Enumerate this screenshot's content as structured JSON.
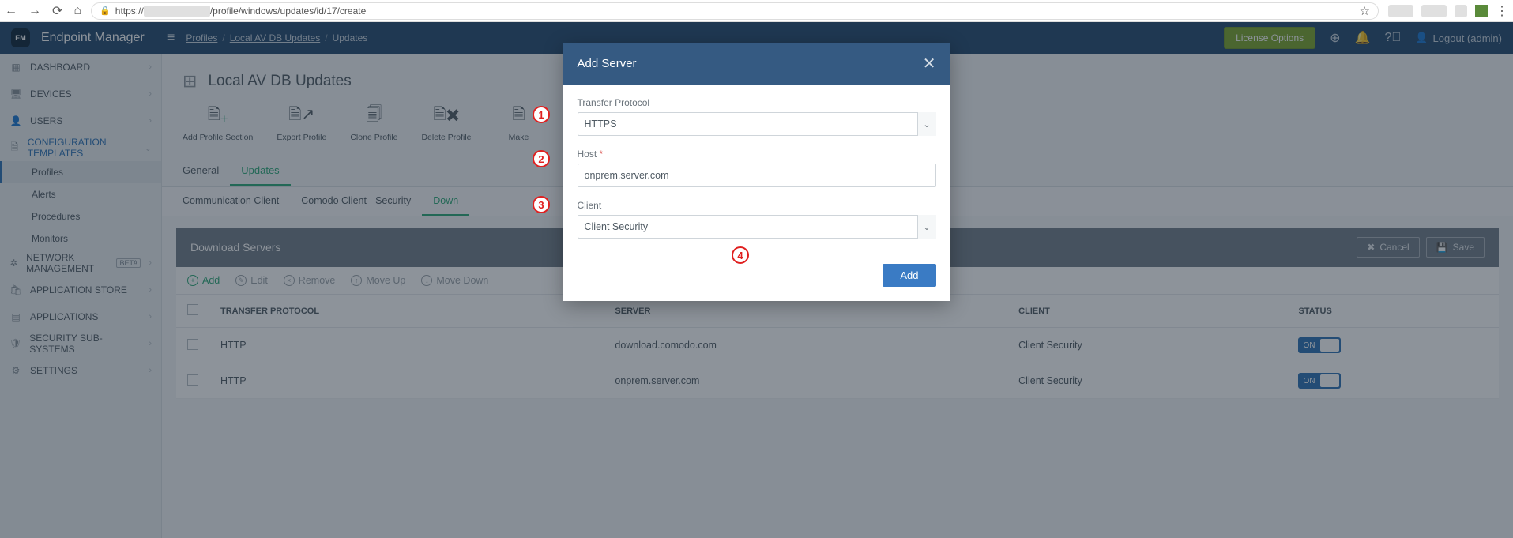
{
  "browser": {
    "url_prefix": "https://",
    "url_mid": "/profile/windows/updates/id/17/create"
  },
  "app": {
    "name": "Endpoint Manager",
    "breadcrumbs": {
      "a": "Profiles",
      "b": "Local AV DB Updates",
      "c": "Updates"
    },
    "license_btn": "License Options",
    "logout": "Logout (admin)"
  },
  "sidebar": {
    "dashboard": "DASHBOARD",
    "devices": "DEVICES",
    "users": "USERS",
    "cfg": "CONFIGURATION TEMPLATES",
    "profiles": "Profiles",
    "alerts": "Alerts",
    "procedures": "Procedures",
    "monitors": "Monitors",
    "network": "NETWORK MANAGEMENT",
    "beta": "BETA",
    "appstore": "APPLICATION STORE",
    "applications": "APPLICATIONS",
    "security": "SECURITY SUB-SYSTEMS",
    "settings": "SETTINGS"
  },
  "page": {
    "title": "Local AV DB Updates",
    "actions": {
      "add_section": "Add Profile Section",
      "export": "Export Profile",
      "clone": "Clone Profile",
      "delete": "Delete Profile",
      "make": "Make"
    },
    "tabs": {
      "general": "General",
      "updates": "Updates"
    },
    "subtabs": {
      "comm": "Communication Client",
      "ccs": "Comodo Client - Security",
      "down": "Down"
    }
  },
  "panel": {
    "title": "Download Servers",
    "cancel": "Cancel",
    "save": "Save",
    "toolbar": {
      "add": "Add",
      "edit": "Edit",
      "remove": "Remove",
      "moveup": "Move Up",
      "movedown": "Move Down"
    },
    "columns": {
      "proto": "TRANSFER PROTOCOL",
      "server": "SERVER",
      "client": "CLIENT",
      "status": "STATUS"
    },
    "rows": [
      {
        "proto": "HTTP",
        "server": "download.comodo.com",
        "client": "Client Security",
        "status": "ON"
      },
      {
        "proto": "HTTP",
        "server": "onprem.server.com",
        "client": "Client Security",
        "status": "ON"
      }
    ]
  },
  "modal": {
    "title": "Add Server",
    "labels": {
      "proto": "Transfer Protocol",
      "host": "Host",
      "client": "Client"
    },
    "values": {
      "proto": "HTTPS",
      "host": "onprem.server.com",
      "client": "Client Security"
    },
    "add_btn": "Add"
  },
  "callouts": {
    "c1": "1",
    "c2": "2",
    "c3": "3",
    "c4": "4"
  }
}
